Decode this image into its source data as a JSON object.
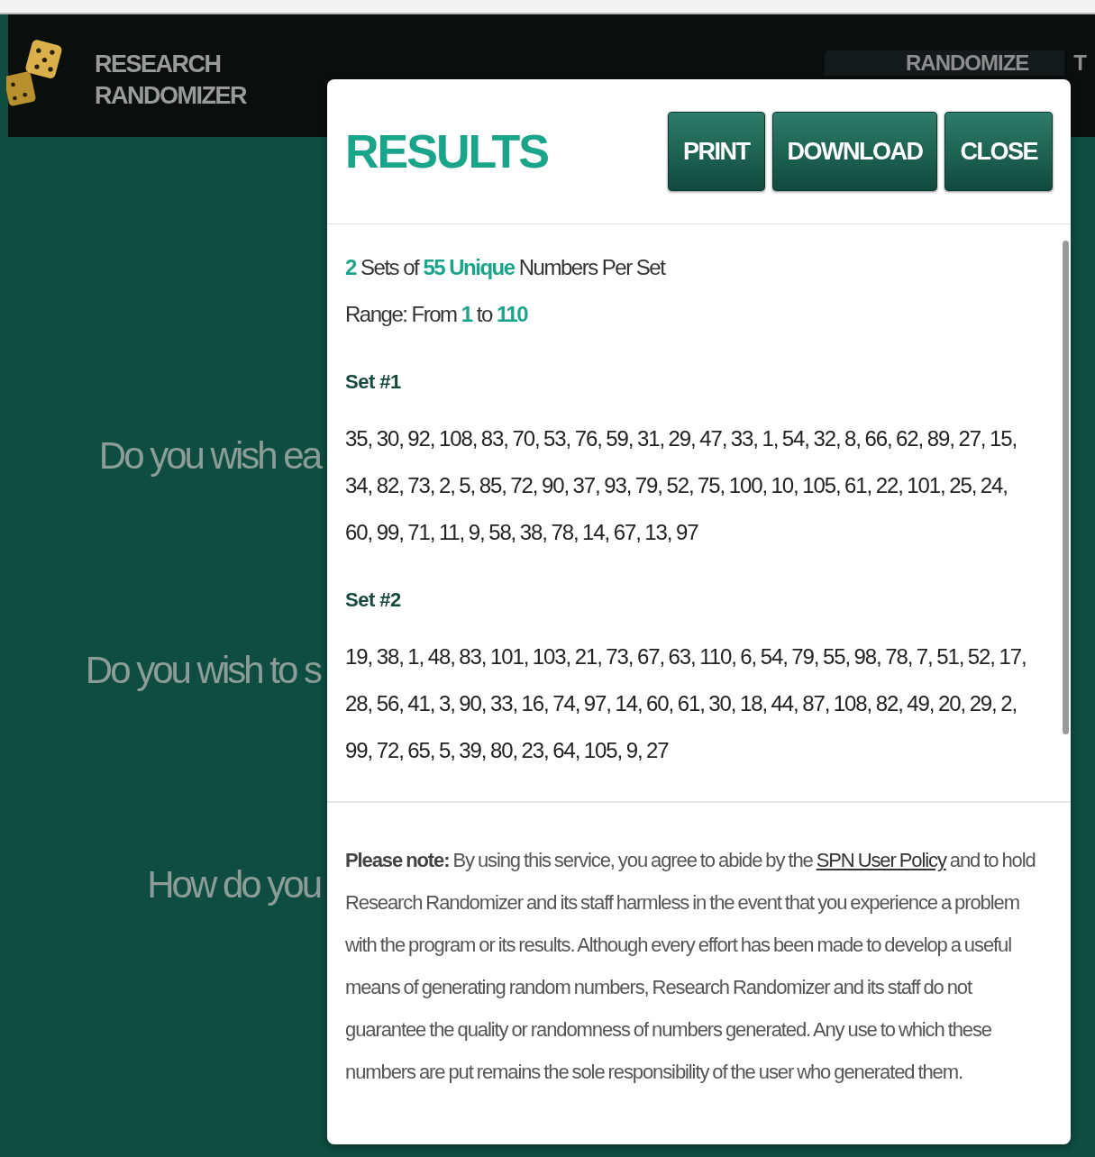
{
  "header": {
    "logo_lines": [
      "RESEARCH",
      "RANDOMIZER"
    ],
    "nav": [
      "RANDOMIZE",
      "T"
    ]
  },
  "background_questions": [
    "Do you wish ea",
    "Do you wish to s",
    "How do you"
  ],
  "modal": {
    "title": "RESULTS",
    "buttons": [
      "PRINT",
      "DOWNLOAD",
      "CLOSE"
    ],
    "summary": [
      "**2** Sets of **55 Unique** Numbers Per Set",
      "Range: From **1** to **110**"
    ],
    "sets": [
      {
        "title": "Set #1",
        "numbers": "35, 30, 92, 108, 83, 70, 53, 76, 59, 31, 29, 47, 33, 1, 54, 32, 8, 66, 62, 89, 27, 15, 34, 82, 73, 2, 5, 85, 72, 90, 37, 93, 79, 52, 75, 100, 10, 105, 61, 22, 101, 25, 24, 60, 99, 71, 11, 9, 58, 38, 78, 14, 67, 13, 97"
      },
      {
        "title": "Set #2",
        "numbers": "19, 38, 1, 48, 83, 101, 103, 21, 73, 67, 63, 110, 6, 54, 79, 55, 98, 78, 7, 51, 52, 17, 28, 56, 41, 3, 90, 33, 16, 74, 97, 14, 60, 61, 30, 18, 44, 87, 108, 82, 49, 20, 29, 2, 99, 72, 65, 5, 39, 80, 23, 64, 105, 9, 27"
      }
    ],
    "note": {
      "before": "**Please note:** By using this service, you agree to abide by the",
      "link": "SPN User Policy",
      "after": "and to hold Research Randomizer and its staff harmless in the event that you experience a problem with the program or its results. Although every effort has been made to develop a useful means of generating random numbers, Research Randomizer and its staff do not guarantee the quality or randomness of numbers generated. Any use to which these numbers are put remains the sole responsibility of the user who generated them."
    }
  }
}
